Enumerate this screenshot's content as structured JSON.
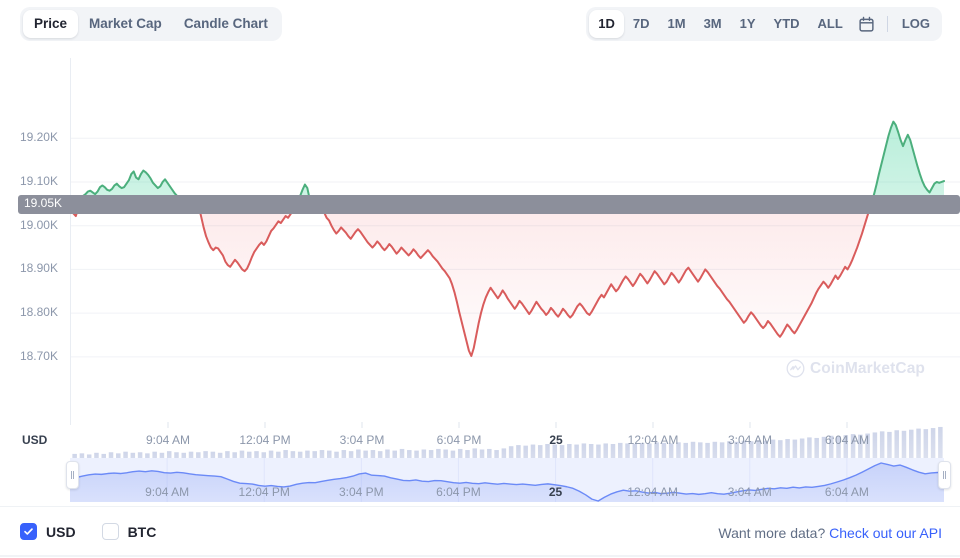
{
  "toolbar": {
    "chart_type_tabs": [
      {
        "label": "Price",
        "active": true
      },
      {
        "label": "Market Cap",
        "active": false
      },
      {
        "label": "Candle Chart",
        "active": false
      }
    ],
    "range_tabs": [
      {
        "label": "1D",
        "active": true
      },
      {
        "label": "7D",
        "active": false
      },
      {
        "label": "1M",
        "active": false
      },
      {
        "label": "3M",
        "active": false
      },
      {
        "label": "1Y",
        "active": false
      },
      {
        "label": "YTD",
        "active": false
      },
      {
        "label": "ALL",
        "active": false
      }
    ],
    "calendar_icon": "calendar-icon",
    "log_label": "LOG"
  },
  "footer": {
    "currency_options": [
      {
        "label": "USD",
        "checked": true
      },
      {
        "label": "BTC",
        "checked": false
      }
    ],
    "api_prompt": "Want more data?",
    "api_link": "Check out our API"
  },
  "watermark": {
    "text": "CoinMarketCap",
    "logo_icon": "coinmarketcap-logo-icon"
  },
  "colors": {
    "up": "#16c784",
    "down": "#ea3943",
    "line_up": "#4caf7d",
    "line_down": "#d95c5c",
    "accent": "#3861fb",
    "navigator": "#6b8af7",
    "volume_bar": "#ccd3e8",
    "grid": "#f0f2f6",
    "badge_bg": "#8c8f9b"
  },
  "chart_data": {
    "type": "area",
    "title": "",
    "xlabel": "USD",
    "ylabel": "",
    "currency": "USD",
    "grid": true,
    "legend": "none",
    "ylim": [
      18670,
      19260
    ],
    "ytick_labels": [
      "19.20K",
      "19.10K",
      "19.00K",
      "18.90K",
      "18.80K",
      "18.70K"
    ],
    "ytick_values": [
      19200,
      19100,
      19000,
      18900,
      18800,
      18700
    ],
    "current_price_label": "19.05K",
    "current_price_value": 19050,
    "reference_line": 19050,
    "xtick_labels": [
      "9:04 AM",
      "12:04 PM",
      "3:04 PM",
      "6:04 PM",
      "25",
      "12:04 AM",
      "3:04 AM",
      "6:04 AM"
    ],
    "xtick_bold_index": 4,
    "series": [
      {
        "name": "Price",
        "unit": "USD",
        "values": [
          19048,
          19028,
          19022,
          19040,
          19062,
          19068,
          19072,
          19078,
          19080,
          19076,
          19072,
          19078,
          19088,
          19092,
          19088,
          19082,
          19080,
          19084,
          19092,
          19096,
          19090,
          19086,
          19088,
          19096,
          19104,
          19118,
          19124,
          19110,
          19106,
          19118,
          19126,
          19122,
          19116,
          19108,
          19098,
          19092,
          19086,
          19090,
          19100,
          19106,
          19098,
          19090,
          19082,
          19074,
          19068,
          19064,
          19060,
          19062,
          19058,
          19052,
          19048,
          19056,
          19052,
          19044,
          19020,
          18996,
          18976,
          18962,
          18950,
          18944,
          18950,
          18948,
          18940,
          18932,
          18918,
          18910,
          18906,
          18914,
          18922,
          18916,
          18908,
          18900,
          18896,
          18902,
          18914,
          18928,
          18940,
          18948,
          18956,
          18962,
          18956,
          18964,
          18976,
          18988,
          18994,
          19002,
          19010,
          19006,
          19014,
          19022,
          19018,
          19026,
          19034,
          19044,
          19052,
          19068,
          19082,
          19094,
          19086,
          19060,
          19058,
          19064,
          19058,
          19050,
          19042,
          19030,
          19018,
          19012,
          19000,
          18990,
          18982,
          18988,
          18996,
          18990,
          18984,
          18976,
          18970,
          18978,
          18986,
          18992,
          18986,
          18978,
          18970,
          18962,
          18956,
          18950,
          18956,
          18964,
          18958,
          18950,
          18944,
          18950,
          18958,
          18952,
          18944,
          18936,
          18942,
          18950,
          18944,
          18938,
          18932,
          18938,
          18946,
          18940,
          18932,
          18926,
          18932,
          18938,
          18944,
          18938,
          18930,
          18924,
          18918,
          18910,
          18902,
          18896,
          18888,
          18880,
          18866,
          18848,
          18826,
          18802,
          18780,
          18758,
          18736,
          18714,
          18702,
          18720,
          18748,
          18776,
          18800,
          18820,
          18836,
          18848,
          18858,
          18850,
          18842,
          18834,
          18842,
          18852,
          18844,
          18834,
          18826,
          18818,
          18810,
          18818,
          18828,
          18822,
          18814,
          18806,
          18798,
          18806,
          18816,
          18826,
          18818,
          18810,
          18804,
          18796,
          18802,
          18812,
          18806,
          18798,
          18792,
          18800,
          18810,
          18804,
          18796,
          18790,
          18796,
          18806,
          18816,
          18822,
          18816,
          18808,
          18800,
          18796,
          18804,
          18814,
          18824,
          18834,
          18842,
          18836,
          18846,
          18856,
          18866,
          18858,
          18850,
          18856,
          18866,
          18876,
          18884,
          18878,
          18870,
          18862,
          18870,
          18880,
          18890,
          18884,
          18876,
          18868,
          18876,
          18886,
          18896,
          18890,
          18882,
          18874,
          18866,
          18872,
          18882,
          18892,
          18886,
          18878,
          18870,
          18878,
          18888,
          18898,
          18904,
          18896,
          18888,
          18880,
          18872,
          18880,
          18890,
          18900,
          18894,
          18886,
          18878,
          18870,
          18862,
          18856,
          18848,
          18840,
          18832,
          18826,
          18818,
          18810,
          18802,
          18794,
          18786,
          18778,
          18784,
          18794,
          18802,
          18796,
          18788,
          18780,
          18772,
          18766,
          18772,
          18782,
          18776,
          18768,
          18760,
          18752,
          18746,
          18754,
          18764,
          18774,
          18768,
          18760,
          18754,
          18762,
          18772,
          18782,
          18792,
          18802,
          18812,
          18822,
          18834,
          18846,
          18856,
          18864,
          18872,
          18866,
          18858,
          18866,
          18876,
          18886,
          18878,
          18886,
          18896,
          18906,
          18900,
          18910,
          18922,
          18936,
          18950,
          18966,
          18982,
          19000,
          19018,
          19036,
          19054,
          19072,
          19094,
          19118,
          19140,
          19162,
          19184,
          19206,
          19224,
          19238,
          19230,
          19214,
          19196,
          19182,
          19196,
          19208,
          19196,
          19176,
          19156,
          19136,
          19118,
          19102,
          19090,
          19082,
          19076,
          19086,
          19096,
          19100,
          19098,
          19100,
          19102
        ]
      }
    ],
    "volume": {
      "name": "Volume",
      "bar_count": 120,
      "relative_heights": [
        0.42,
        0.43,
        0.41,
        0.44,
        0.42,
        0.45,
        0.43,
        0.46,
        0.44,
        0.45,
        0.43,
        0.46,
        0.44,
        0.47,
        0.45,
        0.44,
        0.46,
        0.45,
        0.47,
        0.46,
        0.44,
        0.47,
        0.45,
        0.48,
        0.46,
        0.47,
        0.45,
        0.48,
        0.46,
        0.49,
        0.47,
        0.46,
        0.48,
        0.47,
        0.49,
        0.48,
        0.46,
        0.49,
        0.47,
        0.5,
        0.48,
        0.49,
        0.47,
        0.5,
        0.48,
        0.51,
        0.49,
        0.48,
        0.5,
        0.49,
        0.51,
        0.5,
        0.48,
        0.51,
        0.49,
        0.52,
        0.5,
        0.51,
        0.49,
        0.52,
        0.56,
        0.58,
        0.57,
        0.59,
        0.58,
        0.6,
        0.59,
        0.58,
        0.6,
        0.59,
        0.61,
        0.6,
        0.59,
        0.61,
        0.6,
        0.62,
        0.61,
        0.6,
        0.62,
        0.61,
        0.63,
        0.62,
        0.61,
        0.63,
        0.62,
        0.64,
        0.63,
        0.62,
        0.64,
        0.63,
        0.65,
        0.64,
        0.66,
        0.65,
        0.67,
        0.66,
        0.68,
        0.67,
        0.69,
        0.68,
        0.7,
        0.72,
        0.71,
        0.73,
        0.75,
        0.74,
        0.76,
        0.78,
        0.77,
        0.79,
        0.81,
        0.83,
        0.82,
        0.85,
        0.84,
        0.86,
        0.88,
        0.87,
        0.89,
        0.91
      ]
    },
    "navigator": {
      "name": "Navigator",
      "selection_start": 0,
      "selection_end": 100,
      "values": [
        19048,
        19030,
        19050,
        19068,
        19078,
        19074,
        19086,
        19092,
        19086,
        19096,
        19112,
        19120,
        19112,
        19124,
        19114,
        19098,
        19092,
        19102,
        19096,
        19082,
        19070,
        19062,
        19056,
        19050,
        19042,
        19010,
        18976,
        18952,
        18946,
        18940,
        18920,
        18910,
        18918,
        18906,
        18900,
        18912,
        18936,
        18952,
        18960,
        18958,
        18976,
        18992,
        19006,
        19016,
        19030,
        19050,
        19080,
        19092,
        19062,
        19058,
        19050,
        19026,
        19008,
        18990,
        18986,
        18996,
        18980,
        18974,
        18988,
        18986,
        18972,
        18958,
        18952,
        18962,
        18950,
        18944,
        18956,
        18946,
        18938,
        18948,
        18940,
        18932,
        18940,
        18930,
        18922,
        18934,
        18942,
        18930,
        18918,
        18902,
        18880,
        18840,
        18790,
        18730,
        18704,
        18756,
        18800,
        18832,
        18854,
        18840,
        18846,
        18828,
        18814,
        18824,
        18806,
        18812,
        18824,
        18812,
        18800,
        18808,
        18796,
        18806,
        18820,
        18806,
        18798,
        18812,
        18830,
        18846,
        18858,
        18850,
        18866,
        18880,
        18874,
        18888,
        18880,
        18896,
        18886,
        18900,
        18894,
        18906,
        18920,
        18942,
        18968,
        18996,
        19028,
        19064,
        19106,
        19150,
        19196,
        19232,
        19212,
        19190,
        19204,
        19172,
        19136,
        19104,
        19082,
        19094,
        19100,
        19102
      ]
    }
  }
}
